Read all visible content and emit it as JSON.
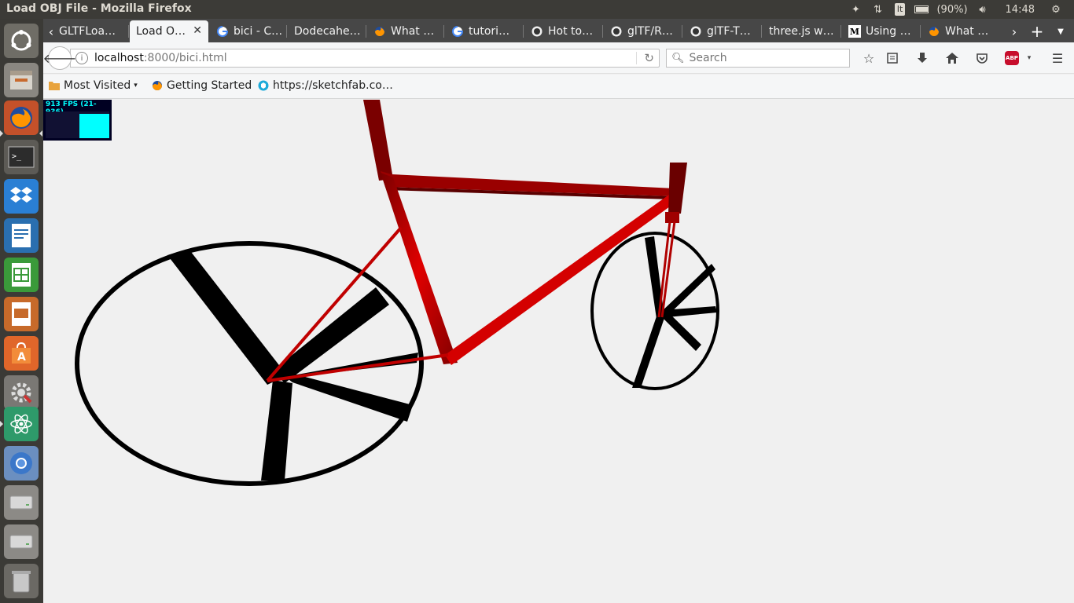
{
  "top_panel": {
    "window_title": "Load OBJ File - Mozilla Firefox",
    "language": "It",
    "battery": "(90%)",
    "time": "14:48"
  },
  "launcher": {
    "items": [
      "dash-home",
      "files",
      "firefox",
      "terminal",
      "dropbox",
      "writer",
      "calc",
      "impress",
      "software-center",
      "system-settings",
      "atom",
      "chromium",
      "disk-1",
      "disk-2",
      "trash"
    ]
  },
  "tabs": [
    {
      "label": "GLTFLoa…",
      "favicon": "none",
      "active": false
    },
    {
      "label": "Load O…",
      "favicon": "none",
      "active": true
    },
    {
      "label": "bici - C…",
      "favicon": "google",
      "active": false
    },
    {
      "label": "Dodecahe…",
      "favicon": "none",
      "active": false
    },
    {
      "label": "What …",
      "favicon": "firefox",
      "active": false
    },
    {
      "label": "tutori…",
      "favicon": "google",
      "active": false
    },
    {
      "label": "Hot to…",
      "favicon": "github",
      "active": false
    },
    {
      "label": "glTF/R…",
      "favicon": "github",
      "active": false
    },
    {
      "label": "glTF-T…",
      "favicon": "github",
      "active": false
    },
    {
      "label": "three.js w…",
      "favicon": "none",
      "active": false
    },
    {
      "label": "Using …",
      "favicon": "medium",
      "active": false
    },
    {
      "label": "What …",
      "favicon": "firefox",
      "active": false
    }
  ],
  "navbar": {
    "url_host": "localhost",
    "url_path": ":8000/bici.html",
    "search_placeholder": "Search"
  },
  "bookmarks": [
    {
      "label": "Most Visited",
      "icon": "folder-icon",
      "dropdown": true
    },
    {
      "label": "Getting Started",
      "icon": "firefox-icon",
      "dropdown": false
    },
    {
      "label": "https://sketchfab.co…",
      "icon": "sketchfab-icon",
      "dropdown": false
    }
  ],
  "stats": {
    "fps_text": "913 FPS (21-936)",
    "fps_level": 0.9
  },
  "scene": {
    "frame_color": "#cc0000",
    "wheel_color": "#000000",
    "background": "#f0f0f0"
  }
}
